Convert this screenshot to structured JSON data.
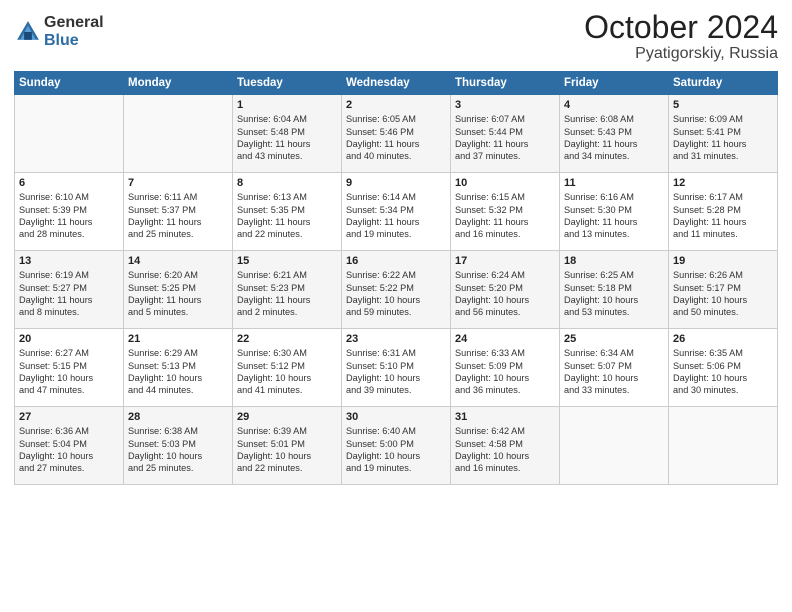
{
  "header": {
    "logo_general": "General",
    "logo_blue": "Blue",
    "month_title": "October 2024",
    "location": "Pyatigorskiy, Russia"
  },
  "days_of_week": [
    "Sunday",
    "Monday",
    "Tuesday",
    "Wednesday",
    "Thursday",
    "Friday",
    "Saturday"
  ],
  "weeks": [
    [
      {
        "day": "",
        "content": ""
      },
      {
        "day": "",
        "content": ""
      },
      {
        "day": "1",
        "content": "Sunrise: 6:04 AM\nSunset: 5:48 PM\nDaylight: 11 hours\nand 43 minutes."
      },
      {
        "day": "2",
        "content": "Sunrise: 6:05 AM\nSunset: 5:46 PM\nDaylight: 11 hours\nand 40 minutes."
      },
      {
        "day": "3",
        "content": "Sunrise: 6:07 AM\nSunset: 5:44 PM\nDaylight: 11 hours\nand 37 minutes."
      },
      {
        "day": "4",
        "content": "Sunrise: 6:08 AM\nSunset: 5:43 PM\nDaylight: 11 hours\nand 34 minutes."
      },
      {
        "day": "5",
        "content": "Sunrise: 6:09 AM\nSunset: 5:41 PM\nDaylight: 11 hours\nand 31 minutes."
      }
    ],
    [
      {
        "day": "6",
        "content": "Sunrise: 6:10 AM\nSunset: 5:39 PM\nDaylight: 11 hours\nand 28 minutes."
      },
      {
        "day": "7",
        "content": "Sunrise: 6:11 AM\nSunset: 5:37 PM\nDaylight: 11 hours\nand 25 minutes."
      },
      {
        "day": "8",
        "content": "Sunrise: 6:13 AM\nSunset: 5:35 PM\nDaylight: 11 hours\nand 22 minutes."
      },
      {
        "day": "9",
        "content": "Sunrise: 6:14 AM\nSunset: 5:34 PM\nDaylight: 11 hours\nand 19 minutes."
      },
      {
        "day": "10",
        "content": "Sunrise: 6:15 AM\nSunset: 5:32 PM\nDaylight: 11 hours\nand 16 minutes."
      },
      {
        "day": "11",
        "content": "Sunrise: 6:16 AM\nSunset: 5:30 PM\nDaylight: 11 hours\nand 13 minutes."
      },
      {
        "day": "12",
        "content": "Sunrise: 6:17 AM\nSunset: 5:28 PM\nDaylight: 11 hours\nand 11 minutes."
      }
    ],
    [
      {
        "day": "13",
        "content": "Sunrise: 6:19 AM\nSunset: 5:27 PM\nDaylight: 11 hours\nand 8 minutes."
      },
      {
        "day": "14",
        "content": "Sunrise: 6:20 AM\nSunset: 5:25 PM\nDaylight: 11 hours\nand 5 minutes."
      },
      {
        "day": "15",
        "content": "Sunrise: 6:21 AM\nSunset: 5:23 PM\nDaylight: 11 hours\nand 2 minutes."
      },
      {
        "day": "16",
        "content": "Sunrise: 6:22 AM\nSunset: 5:22 PM\nDaylight: 10 hours\nand 59 minutes."
      },
      {
        "day": "17",
        "content": "Sunrise: 6:24 AM\nSunset: 5:20 PM\nDaylight: 10 hours\nand 56 minutes."
      },
      {
        "day": "18",
        "content": "Sunrise: 6:25 AM\nSunset: 5:18 PM\nDaylight: 10 hours\nand 53 minutes."
      },
      {
        "day": "19",
        "content": "Sunrise: 6:26 AM\nSunset: 5:17 PM\nDaylight: 10 hours\nand 50 minutes."
      }
    ],
    [
      {
        "day": "20",
        "content": "Sunrise: 6:27 AM\nSunset: 5:15 PM\nDaylight: 10 hours\nand 47 minutes."
      },
      {
        "day": "21",
        "content": "Sunrise: 6:29 AM\nSunset: 5:13 PM\nDaylight: 10 hours\nand 44 minutes."
      },
      {
        "day": "22",
        "content": "Sunrise: 6:30 AM\nSunset: 5:12 PM\nDaylight: 10 hours\nand 41 minutes."
      },
      {
        "day": "23",
        "content": "Sunrise: 6:31 AM\nSunset: 5:10 PM\nDaylight: 10 hours\nand 39 minutes."
      },
      {
        "day": "24",
        "content": "Sunrise: 6:33 AM\nSunset: 5:09 PM\nDaylight: 10 hours\nand 36 minutes."
      },
      {
        "day": "25",
        "content": "Sunrise: 6:34 AM\nSunset: 5:07 PM\nDaylight: 10 hours\nand 33 minutes."
      },
      {
        "day": "26",
        "content": "Sunrise: 6:35 AM\nSunset: 5:06 PM\nDaylight: 10 hours\nand 30 minutes."
      }
    ],
    [
      {
        "day": "27",
        "content": "Sunrise: 6:36 AM\nSunset: 5:04 PM\nDaylight: 10 hours\nand 27 minutes."
      },
      {
        "day": "28",
        "content": "Sunrise: 6:38 AM\nSunset: 5:03 PM\nDaylight: 10 hours\nand 25 minutes."
      },
      {
        "day": "29",
        "content": "Sunrise: 6:39 AM\nSunset: 5:01 PM\nDaylight: 10 hours\nand 22 minutes."
      },
      {
        "day": "30",
        "content": "Sunrise: 6:40 AM\nSunset: 5:00 PM\nDaylight: 10 hours\nand 19 minutes."
      },
      {
        "day": "31",
        "content": "Sunrise: 6:42 AM\nSunset: 4:58 PM\nDaylight: 10 hours\nand 16 minutes."
      },
      {
        "day": "",
        "content": ""
      },
      {
        "day": "",
        "content": ""
      }
    ]
  ]
}
